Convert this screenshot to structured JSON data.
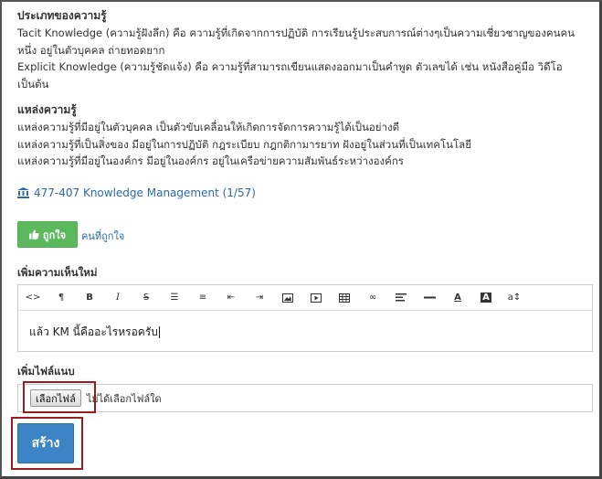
{
  "knowledge": {
    "types_heading": "ประเภทของความรู้",
    "tacit_line1": "Tacit Knowledge (ความรู้ฝังลึก) คือ ความรู้ที่เกิดจากการปฏิบัติ การเรียนรู้ประสบการณ์ต่างๆเป็นความเชี่ยวชาญของคนคน",
    "tacit_line2": "หนึ่ง อยู่ในตัวบุคคล ถ่ายทอดยาก",
    "explicit_line1": "Explicit Knowledge (ความรู้ชัดแจ้ง) คือ ความรู้ที่สามารถเขียนแสดงออกมาเป็นคำพูด ตัวเลขได้ เช่น หนังสือคู่มือ วิดีโอ",
    "explicit_line2": "เป็นต้น",
    "sources_heading": "แหล่งความรู้",
    "source1": "แหล่งความรู้ที่มีอยู่ในตัวบุคคล เป็นตัวขับเคลื่อนให้เกิดการจัดการความรู้ได้เป็นอย่างดี",
    "source2": "แหล่งความรู้ที่เป็นสิ่งของ มีอยู่ในการปฏิบัติ กฎระเบียบ กฎกติกามารยาท ฝังอยู่ในส่วนที่เป็นเทคโนโลยี",
    "source3": "แหล่งความรู้ที่มีอยู่ในองค์กร มีอยู่ในองค์กร อยู่ในเครือข่ายความสัมพันธ์ระหว่างองค์กร"
  },
  "course_link": "477-407 Knowledge Management (1/57)",
  "like_button": "ถูกใจ",
  "likers_link": "คนที่ถูกใจ",
  "comment_label": "เพิ่มความเห็นใหม่",
  "editor_text": "แล้ว KM นี้คืออะไรหรอครับ",
  "attach_label": "เพิ่มไฟล์แนบ",
  "choose_file_button": "เลือกไฟล์",
  "no_file_text": "ไม่ได้เลือกไฟล์ใด",
  "create_button": "สร้าง",
  "toolbar_icons": [
    "code-icon",
    "paragraph-icon",
    "bold-icon",
    "italic-icon",
    "strikethrough-icon",
    "unordered-list-icon",
    "ordered-list-icon",
    "outdent-icon",
    "indent-icon",
    "image-icon",
    "video-icon",
    "table-icon",
    "link-icon",
    "align-icon",
    "horizontal-rule-icon",
    "font-color-icon",
    "background-color-icon",
    "font-size-icon"
  ],
  "colors": {
    "like_green": "#5cb85c",
    "primary_blue": "#3c84c6",
    "link_blue": "#2a6aa8",
    "highlight_red": "#9b1c1c"
  }
}
